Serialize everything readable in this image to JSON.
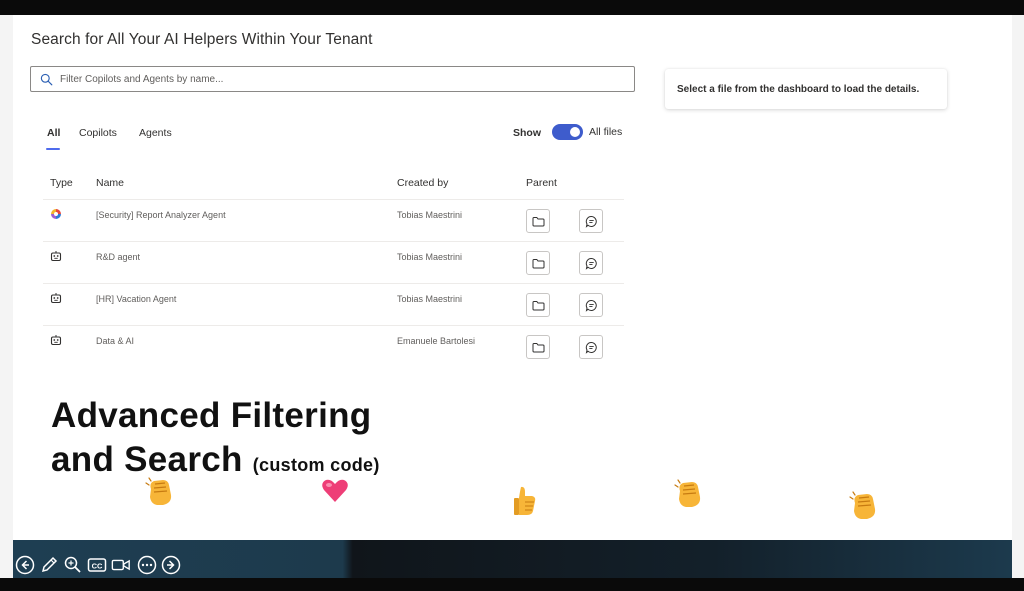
{
  "header": {
    "title": "Search for All Your AI Helpers Within Your Tenant"
  },
  "search": {
    "placeholder": "Filter Copilots and Agents by name..."
  },
  "details": {
    "message": "Select a file from the dashboard to load the details."
  },
  "tabs": [
    {
      "label": "All",
      "active": true
    },
    {
      "label": "Copilots",
      "active": false
    },
    {
      "label": "Agents",
      "active": false
    }
  ],
  "toggle": {
    "show_label": "Show",
    "state": "on",
    "label": "All files"
  },
  "table": {
    "columns": [
      "Type",
      "Name",
      "Created by",
      "Parent"
    ],
    "rows": [
      {
        "type_icon": "copilot-icon",
        "name": "[Security] Report Analyzer Agent",
        "created_by": "Tobias Maestrini"
      },
      {
        "type_icon": "bot-icon",
        "name": "R&D agent",
        "created_by": "Tobias Maestrini"
      },
      {
        "type_icon": "bot-icon",
        "name": "[HR] Vacation Agent",
        "created_by": "Tobias Maestrini"
      },
      {
        "type_icon": "bot-icon",
        "name": "Data & AI",
        "created_by": "Emanuele Bartolesi"
      }
    ],
    "row_actions": [
      "folder-icon",
      "chat-icon"
    ]
  },
  "caption": {
    "line1": "Advanced Filtering",
    "line2": "and Search",
    "line2_suffix": "(custom code)"
  },
  "reactions": [
    "clapping-hands-emoji",
    "heart-emoji",
    "thumbs-up-emoji",
    "clapping-hands-emoji",
    "clapping-hands-emoji"
  ],
  "presenter_controls": [
    "previous-icon",
    "pen-icon",
    "zoom-icon",
    "captions-icon",
    "video-icon",
    "more-icon",
    "next-icon"
  ],
  "colors": {
    "accent": "#3e5ccc",
    "tab_underline": "#4f6bed"
  }
}
